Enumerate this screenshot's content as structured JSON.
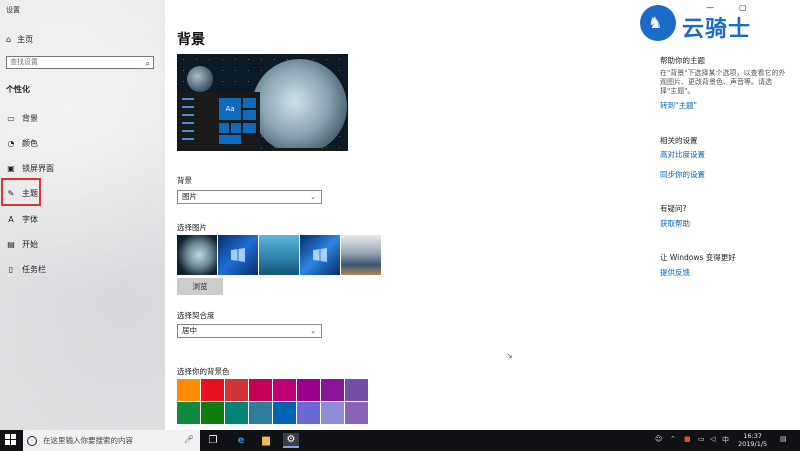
{
  "window": {
    "title": "设置",
    "controls": [
      "—",
      "▢"
    ]
  },
  "brand": {
    "name": "云骑士"
  },
  "sidebar": {
    "home": "主页",
    "search_placeholder": "查找设置",
    "section": "个性化",
    "items": [
      {
        "label": "背景",
        "icon": "image-icon"
      },
      {
        "label": "颜色",
        "icon": "palette-icon"
      },
      {
        "label": "锁屏界面",
        "icon": "lock-screen-icon"
      },
      {
        "label": "主题",
        "icon": "brush-icon",
        "selected": true
      },
      {
        "label": "字体",
        "icon": "font-icon"
      },
      {
        "label": "开始",
        "icon": "start-icon"
      },
      {
        "label": "任务栏",
        "icon": "taskbar-icon"
      }
    ]
  },
  "main": {
    "title": "背景",
    "preview_tile": "Aa",
    "background_label": "背景",
    "background_value": "图片",
    "choose_picture_label": "选择图片",
    "browse_label": "浏览",
    "fit_label": "选择契合度",
    "fit_value": "居中",
    "color_label": "选择你的背景色",
    "colors": [
      "#ff8c00",
      "#e81123",
      "#d13438",
      "#c30052",
      "#bf0077",
      "#9a0089",
      "#881798",
      "#744da9",
      "#10893e",
      "#107c10",
      "#018574",
      "#2d7d9a",
      "#0063b1",
      "#6b69d6",
      "#8e8cd8",
      "#8764b8"
    ]
  },
  "right_panel": {
    "help_title": "帮助你的主题",
    "help_text": "在\"背景\"下选择某个选项，以查看它的外观图片、更改背景色、声音等。请选择\"主题\"。",
    "help_link": "转到\"主题\"",
    "related_title": "相关的设置",
    "related_links": [
      "高对比度设置",
      "同步你的设置"
    ],
    "question_title": "有疑问?",
    "question_link": "获取帮助",
    "improve_title": "让 Windows 变得更好",
    "improve_link": "提供反馈"
  },
  "taskbar": {
    "search_text": "在这里输入你要搜索的内容",
    "tray_ime": "中",
    "time": "16:37",
    "date": "2019/1/5"
  }
}
